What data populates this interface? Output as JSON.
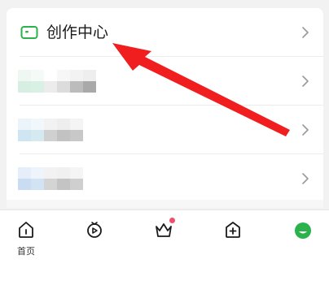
{
  "menu": {
    "creator_center": {
      "label": "创作中心",
      "icon": "video-camera-icon",
      "icon_color": "#2bb24c"
    },
    "rows": [
      {
        "label": "",
        "icon": "placeholder"
      },
      {
        "label": "",
        "icon": "placeholder"
      },
      {
        "label": "",
        "icon": "placeholder"
      }
    ]
  },
  "tabbar": {
    "items": [
      {
        "label": "首页",
        "icon": "home-icon"
      },
      {
        "label": "",
        "icon": "video-icon"
      },
      {
        "label": "",
        "icon": "crown-icon",
        "badge": true
      },
      {
        "label": "",
        "icon": "add-icon"
      },
      {
        "label": "",
        "icon": "profile-avatar-icon",
        "color": "#2bb24c"
      }
    ]
  },
  "colors": {
    "accent": "#2bb24c",
    "annotation_arrow": "#f01e1e"
  }
}
